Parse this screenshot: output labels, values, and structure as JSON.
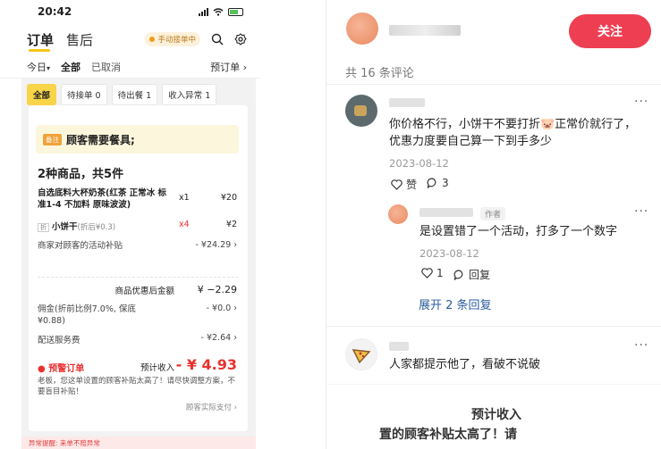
{
  "status_bar": {
    "time": "20:42"
  },
  "left": {
    "tabs": {
      "orders": "订单",
      "after_sale": "售后"
    },
    "manual_accept": "手动接单中",
    "filter": {
      "today": "今日",
      "all": "全部",
      "cancelled": "已取消",
      "preorder": "预订单 ›"
    },
    "chips": [
      "全部",
      "待接单 0",
      "待出餐 1",
      "收入异常 1"
    ],
    "note_tag": "备注",
    "note_text": "顾客需要餐具;",
    "count": "2种商品，共5件",
    "item1": {
      "name": "自选底料大杯奶茶(红茶 正常冰 标准1-4 不加料 原味波波)",
      "qty": "x1",
      "price": "¥20"
    },
    "item2": {
      "badge": "折",
      "name": "小饼干",
      "sub": "(折后¥0.3)",
      "qty": "x4",
      "price": "¥2"
    },
    "subsidy": {
      "label": "商家对顾客的活动补贴",
      "value": "- ¥24.29 ›"
    },
    "discounted": {
      "label": "商品优惠后金额",
      "value": "¥ −2.29"
    },
    "commission": {
      "label": "佣金(折前比例7.0%, 保底¥0.88)",
      "value": "- ¥0.0 ›"
    },
    "delivery": {
      "label": "配送服务费",
      "value": "- ¥2.64 ›"
    },
    "warning": {
      "label": "预警订单",
      "expected_label": "预计收入",
      "expected_value": "- ¥ 4.93"
    },
    "warning_text": "老板，您这单设置的顾客补贴太高了！请尽快调整方案，不要盲目补贴！",
    "customer_pay": "顾客实际支付 ›",
    "bottom_warn": "异常提醒: 来单不赔异常"
  },
  "right": {
    "follow": "关注",
    "comment_count": "共 16 条评论",
    "c1": {
      "text_line1": "你价格不行，小饼干不要打折🐷正常价就行了，",
      "text_line2": "优惠力度要自己算一下到手多少",
      "date": "2023-08-12",
      "like": "赞",
      "replies": "3"
    },
    "c2": {
      "author_tag": "作者",
      "text": "是设置错了一个活动，打多了一个数字",
      "date": "2023-08-12",
      "like": "1",
      "reply": "回复"
    },
    "expand": "展开 2 条回复",
    "c3": {
      "text": "人家都提示他了，看破不说破"
    },
    "bottom_line1": "预计收入",
    "bottom_line2": "置的顾客补贴太高了！请"
  }
}
